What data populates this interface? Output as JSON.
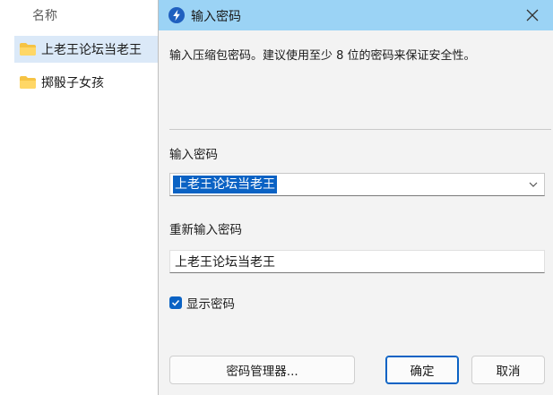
{
  "explorer": {
    "column_header": "名称",
    "items": [
      {
        "name": "上老王论坛当老王",
        "selected": true
      },
      {
        "name": "掷骰子女孩",
        "selected": false
      }
    ],
    "folder_color": "#f6c343"
  },
  "dialog": {
    "title": "输入密码",
    "title_icon": "lightning-bolt-icon",
    "description": "输入压缩包密码。建议使用至少 8 位的密码来保证安全性。",
    "password_label": "输入密码",
    "password_value": "上老王论坛当老王",
    "reenter_label": "重新输入密码",
    "reenter_value": "上老王论坛当老王",
    "show_password_label": "显示密码",
    "show_password_checked": true,
    "buttons": {
      "manager": "密码管理器...",
      "ok": "确定",
      "cancel": "取消"
    },
    "colors": {
      "titlebar": "#9bd3f5",
      "accent": "#0a62c4"
    }
  }
}
